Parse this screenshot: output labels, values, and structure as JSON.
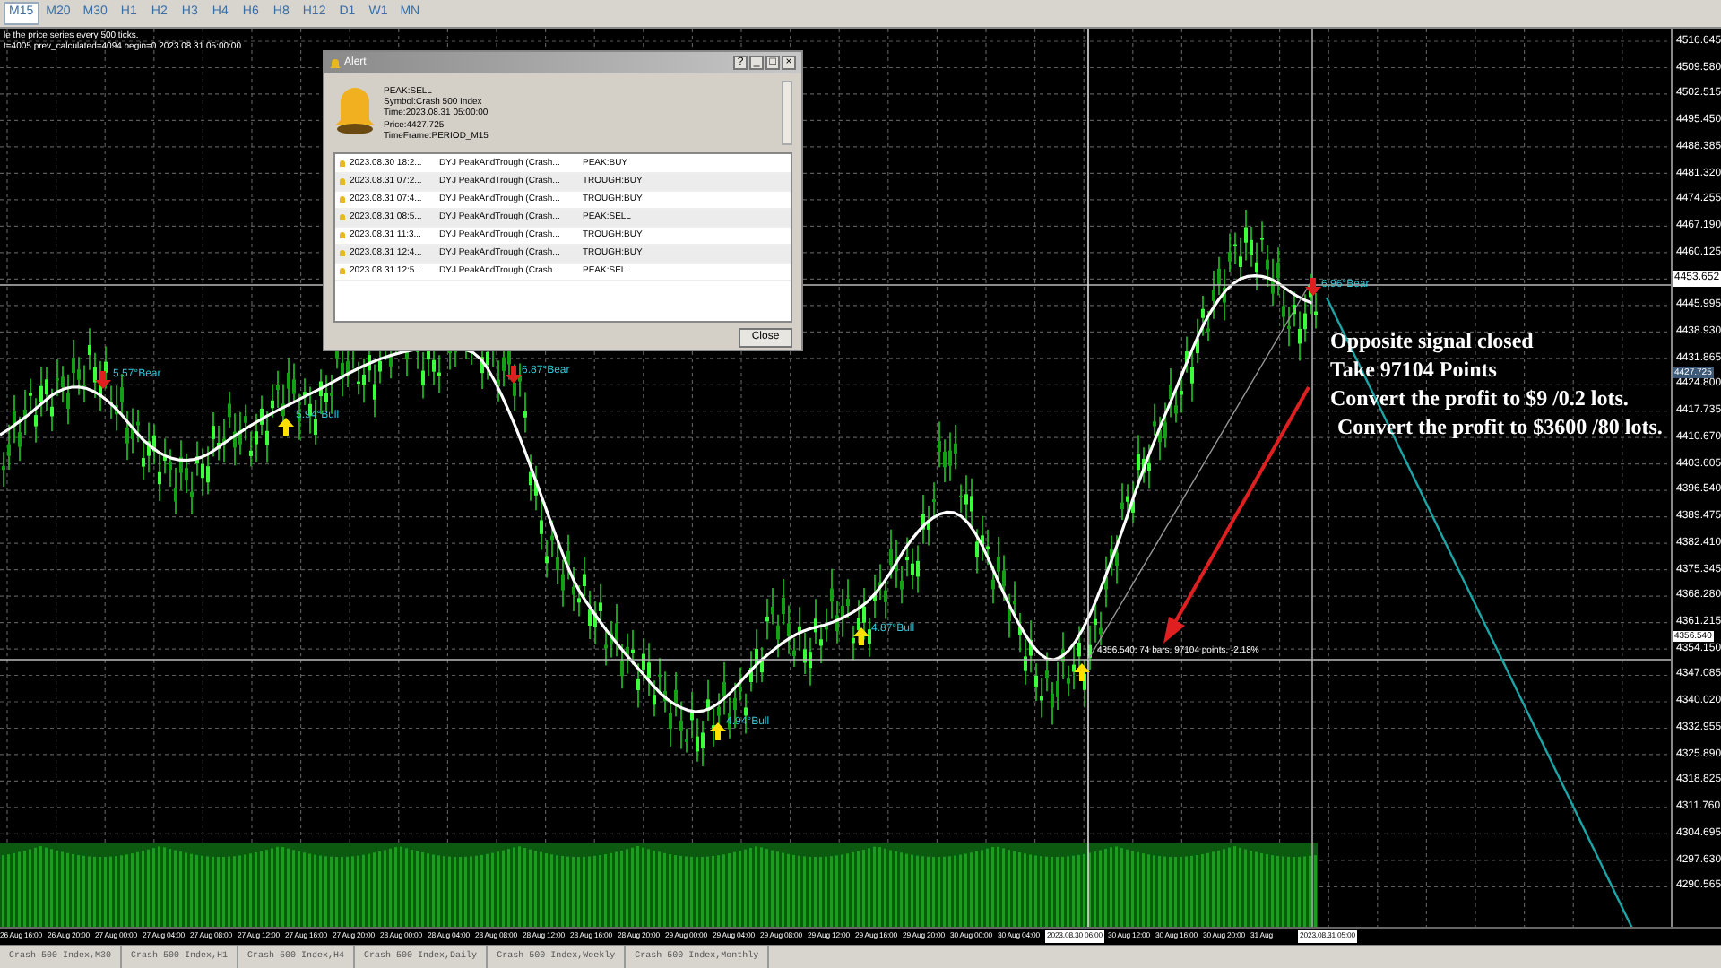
{
  "toolbar": {
    "timeframes": [
      {
        "label": "M15",
        "selected": true
      },
      {
        "label": "M20",
        "selected": false
      },
      {
        "label": "M30",
        "selected": false
      },
      {
        "label": "H1",
        "selected": false
      },
      {
        "label": "H2",
        "selected": false
      },
      {
        "label": "H3",
        "selected": false
      },
      {
        "label": "H4",
        "selected": false
      },
      {
        "label": "H6",
        "selected": false
      },
      {
        "label": "H8",
        "selected": false
      },
      {
        "label": "H12",
        "selected": false
      },
      {
        "label": "D1",
        "selected": false
      },
      {
        "label": "W1",
        "selected": false
      },
      {
        "label": "MN",
        "selected": false
      }
    ]
  },
  "chart": {
    "info_lines": [
      "le the price series every 500 ticks.",
      "t=4005 prev_calculated=4094 begin=0 2023.08.31 05:00:00"
    ],
    "signals": [
      {
        "kind": "bear",
        "label": "5.57°Bear"
      },
      {
        "kind": "bull",
        "label": "5.94°Bull"
      },
      {
        "kind": "bear",
        "label": "6.87°Bear"
      },
      {
        "kind": "bull",
        "label": "4.94°Bull"
      },
      {
        "kind": "bull",
        "label": "4.87°Bull"
      },
      {
        "kind": "bull"
      },
      {
        "kind": "bear",
        "label": "6.96°Bear"
      }
    ],
    "measure_label": "4356.540: 74 bars, 97104 points, -2.18%",
    "note_lines": [
      "Opposite signal closed",
      "Take 97104 Points",
      "Convert the profit to $9 /0.2 lots.",
      "Convert the profit to $3600 /80 lots."
    ],
    "price_axis": [
      {
        "kind": "tick",
        "label": "4516.645"
      },
      {
        "kind": "tick",
        "label": "4509.580"
      },
      {
        "kind": "tick",
        "label": "4502.515"
      },
      {
        "kind": "tick",
        "label": "4495.450"
      },
      {
        "kind": "tick",
        "label": "4488.385"
      },
      {
        "kind": "tick",
        "label": "4481.320"
      },
      {
        "kind": "tick",
        "label": "4474.255"
      },
      {
        "kind": "tick",
        "label": "4467.190"
      },
      {
        "kind": "tick",
        "label": "4460.125"
      },
      {
        "kind": "current",
        "label": "4453.652"
      },
      {
        "kind": "tick",
        "label": "4445.995"
      },
      {
        "kind": "tick",
        "label": "4438.930"
      },
      {
        "kind": "tick",
        "label": "4431.865"
      },
      {
        "kind": "line",
        "label": "4427.725"
      },
      {
        "kind": "tick",
        "label": "4424.800"
      },
      {
        "kind": "tick",
        "label": "4417.735"
      },
      {
        "kind": "tick",
        "label": "4410.670"
      },
      {
        "kind": "tick",
        "label": "4403.605"
      },
      {
        "kind": "tick",
        "label": "4396.540"
      },
      {
        "kind": "tick",
        "label": "4389.475"
      },
      {
        "kind": "tick",
        "label": "4382.410"
      },
      {
        "kind": "tick",
        "label": "4375.345"
      },
      {
        "kind": "tick",
        "label": "4368.280"
      },
      {
        "kind": "tick",
        "label": "4361.215"
      },
      {
        "kind": "marker",
        "label": "4356.540"
      },
      {
        "kind": "tick",
        "label": "4354.150"
      },
      {
        "kind": "tick",
        "label": "4347.085"
      },
      {
        "kind": "tick",
        "label": "4340.020"
      },
      {
        "kind": "tick",
        "label": "4332.955"
      },
      {
        "kind": "tick",
        "label": "4325.890"
      },
      {
        "kind": "tick",
        "label": "4318.825"
      },
      {
        "kind": "tick",
        "label": "4311.760"
      },
      {
        "kind": "tick",
        "label": "4304.695"
      },
      {
        "kind": "tick",
        "label": "4297.630"
      },
      {
        "kind": "tick",
        "label": "4290.565"
      }
    ],
    "time_axis": [
      {
        "kind": "tick",
        "label": "26 Aug 16:00"
      },
      {
        "kind": "tick",
        "label": "26 Aug 20:00"
      },
      {
        "kind": "tick",
        "label": "27 Aug 00:00"
      },
      {
        "kind": "tick",
        "label": "27 Aug 04:00"
      },
      {
        "kind": "tick",
        "label": "27 Aug 08:00"
      },
      {
        "kind": "tick",
        "label": "27 Aug 12:00"
      },
      {
        "kind": "tick",
        "label": "27 Aug 16:00"
      },
      {
        "kind": "tick",
        "label": "27 Aug 20:00"
      },
      {
        "kind": "tick",
        "label": "28 Aug 00:00"
      },
      {
        "kind": "tick",
        "label": "28 Aug 04:00"
      },
      {
        "kind": "tick",
        "label": "28 Aug 08:00"
      },
      {
        "kind": "tick",
        "label": "28 Aug 12:00"
      },
      {
        "kind": "tick",
        "label": "28 Aug 16:00"
      },
      {
        "kind": "tick",
        "label": "28 Aug 20:00"
      },
      {
        "kind": "tick",
        "label": "29 Aug 00:00"
      },
      {
        "kind": "tick",
        "label": "29 Aug 04:00"
      },
      {
        "kind": "tick",
        "label": "29 Aug 08:00"
      },
      {
        "kind": "tick",
        "label": "29 Aug 12:00"
      },
      {
        "kind": "tick",
        "label": "29 Aug 16:00"
      },
      {
        "kind": "tick",
        "label": "29 Aug 20:00"
      },
      {
        "kind": "tick",
        "label": "30 Aug 00:00"
      },
      {
        "kind": "tick",
        "label": "30 Aug 04:00"
      },
      {
        "kind": "marker",
        "label": "2023.08.30 06:00"
      },
      {
        "kind": "tick",
        "label": "30 Aug 12:00"
      },
      {
        "kind": "tick",
        "label": "30 Aug 16:00"
      },
      {
        "kind": "tick",
        "label": "30 Aug 20:00"
      },
      {
        "kind": "tick",
        "label": "31 Aug"
      },
      {
        "kind": "marker",
        "label": "2023.08.31 05:00"
      }
    ]
  },
  "alert": {
    "title": "Alert",
    "window_buttons": [
      "?",
      "_",
      "□",
      "×"
    ],
    "message_lines": [
      "PEAK:SELL",
      "Symbol:Crash 500 Index",
      "Time:2023.08.31 05:00:00",
      "Price:4427.725",
      "TimeFrame:PERIOD_M15"
    ],
    "rows": [
      {
        "time": "2023.08.30 18:2...",
        "source": "DYJ PeakAndTrough (Crash...",
        "signal": "PEAK:BUY"
      },
      {
        "time": "2023.08.31 07:2...",
        "source": "DYJ PeakAndTrough (Crash...",
        "signal": "TROUGH:BUY"
      },
      {
        "time": "2023.08.31 07:4...",
        "source": "DYJ PeakAndTrough (Crash...",
        "signal": "TROUGH:BUY"
      },
      {
        "time": "2023.08.31 08:5...",
        "source": "DYJ PeakAndTrough (Crash...",
        "signal": "PEAK:SELL"
      },
      {
        "time": "2023.08.31 11:3...",
        "source": "DYJ PeakAndTrough (Crash...",
        "signal": "TROUGH:BUY"
      },
      {
        "time": "2023.08.31 12:4...",
        "source": "DYJ PeakAndTrough (Crash...",
        "signal": "TROUGH:BUY"
      },
      {
        "time": "2023.08.31 12:5...",
        "source": "DYJ PeakAndTrough (Crash...",
        "signal": "PEAK:SELL"
      }
    ],
    "close_button": "Close"
  },
  "tabs": [
    {
      "label": "Crash 500 Index,M30"
    },
    {
      "label": "Crash 500 Index,H1"
    },
    {
      "label": "Crash 500 Index,H4"
    },
    {
      "label": "Crash 500 Index,Daily"
    },
    {
      "label": "Crash 500 Index,Weekly"
    },
    {
      "label": "Crash 500 Index,Monthly"
    }
  ]
}
